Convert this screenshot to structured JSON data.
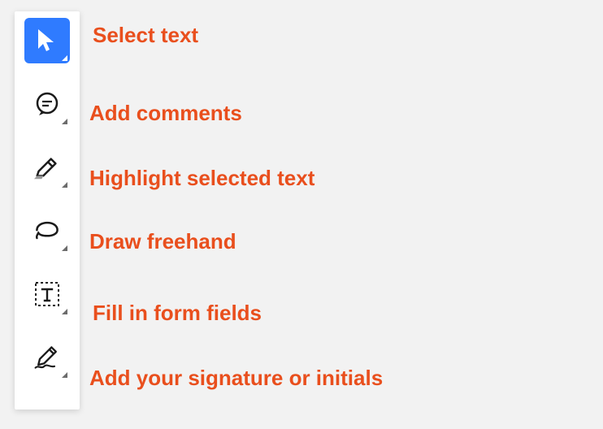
{
  "tools": [
    {
      "label": "Select text"
    },
    {
      "label": "Add comments"
    },
    {
      "label": "Highlight selected text"
    },
    {
      "label": "Draw freehand"
    },
    {
      "label": "Fill in form fields"
    },
    {
      "label": "Add your signature or initials"
    }
  ]
}
